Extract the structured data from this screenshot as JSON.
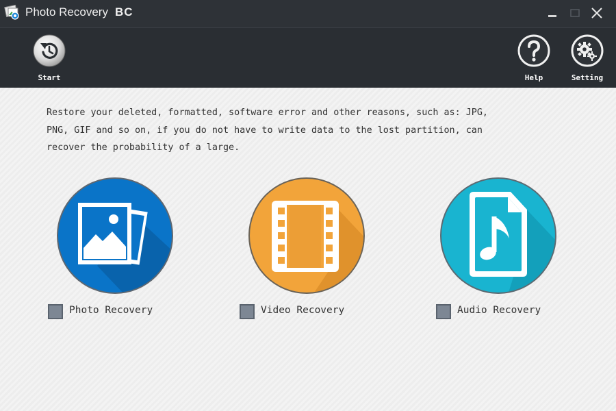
{
  "window": {
    "title": "Photo Recovery",
    "edition": "BC"
  },
  "toolbar": {
    "start_label": "Start",
    "help_label": "Help",
    "setting_label": "Setting"
  },
  "description": {
    "line1": "Restore your deleted, formatted, software error and other reasons, such as: JPG,",
    "line2": "PNG, GIF and so on, if you do not have to write data to the lost partition, can",
    "line3": "recover the probability of a large."
  },
  "modes": [
    {
      "label": "Photo Recovery",
      "color": "#0a74c8",
      "icon": "photo-icon",
      "checked": false
    },
    {
      "label": "Video Recovery",
      "color": "#f2a43a",
      "icon": "film-icon",
      "checked": false
    },
    {
      "label": "Audio Recovery",
      "color": "#19b4d0",
      "icon": "music-file-icon",
      "checked": false
    }
  ],
  "colors": {
    "titlebar": "#2e3237",
    "toolbar": "#2a2e33",
    "background": "#f2f2f2"
  }
}
